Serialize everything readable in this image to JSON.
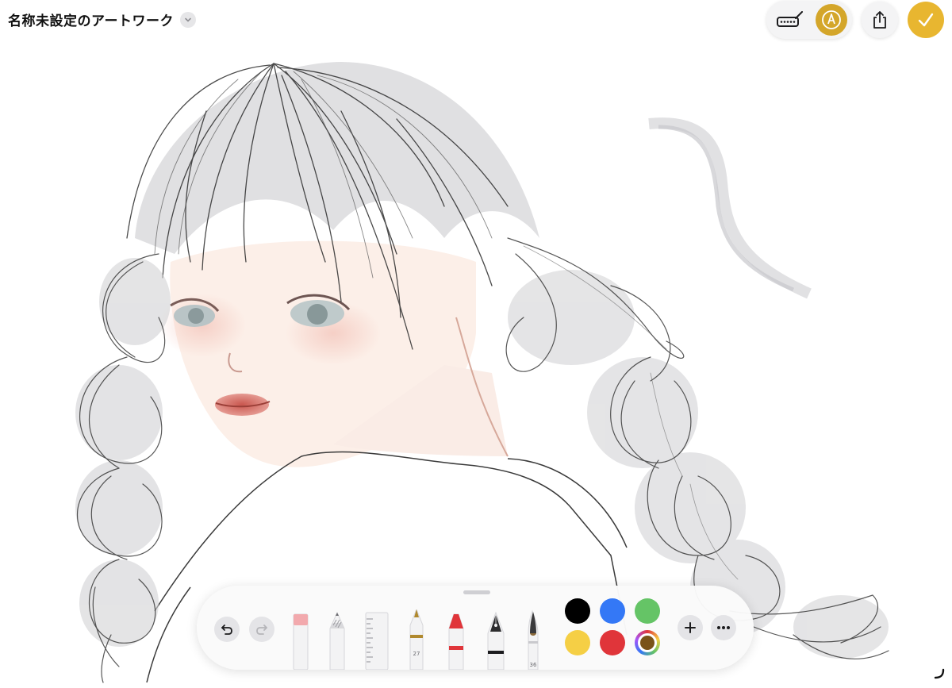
{
  "document": {
    "title": "名称未設定のアートワーク"
  },
  "toolbar_top": {
    "icons": [
      "pen-keyboard-icon",
      "markup-pen-icon",
      "share-icon",
      "checkmark-icon"
    ],
    "accent": "#d4a62a",
    "done_color": "#e8b630"
  },
  "palette": {
    "tools": [
      {
        "name": "eraser",
        "label": ""
      },
      {
        "name": "pencil",
        "label": ""
      },
      {
        "name": "ruler",
        "label": ""
      },
      {
        "name": "monoline-pen",
        "label": "27"
      },
      {
        "name": "crayon",
        "label": ""
      },
      {
        "name": "fountain-pen",
        "label": ""
      },
      {
        "name": "watercolor-brush",
        "label": "36"
      }
    ],
    "colors": [
      "#000000",
      "#3478f6",
      "#65c466",
      "#f5cf45",
      "#e0353a",
      "#7a5318"
    ],
    "selected_color": "#7a5318",
    "actions": [
      "undo-icon",
      "redo-icon",
      "plus-icon",
      "more-icon"
    ]
  }
}
